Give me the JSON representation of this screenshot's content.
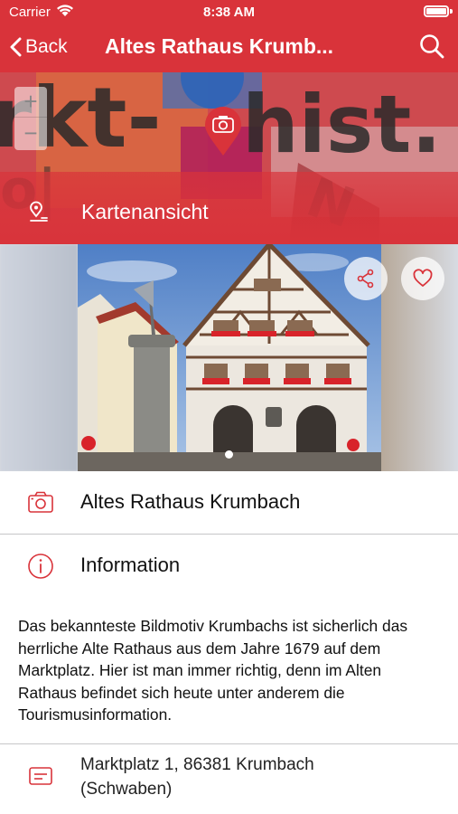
{
  "status_bar": {
    "carrier": "Carrier",
    "time": "8:38 AM"
  },
  "nav": {
    "back_label": "Back",
    "title": "Altes Rathaus Krumb...",
    "icons": [
      "back-chevron-icon",
      "search-icon"
    ]
  },
  "map": {
    "zoom_in": "+",
    "zoom_out": "−",
    "link_label": "Kartenansicht",
    "icons": [
      "map-pin-icon",
      "camera-pin-icon"
    ]
  },
  "carousel": {
    "image_count": 1,
    "active_index": 0,
    "icons": [
      "share-icon",
      "heart-icon"
    ]
  },
  "details": {
    "title_row": "Altes Rathaus Krumbach",
    "info_row": "Information",
    "description": "Das bekannteste Bildmotiv Krumbachs ist sicherlich das herrliche Alte Rathaus aus dem Jahre 1679 auf dem Marktplatz. Hier ist man immer richtig, denn im Alten Rathaus befindet sich heute unter anderem die Tourismusinformation.",
    "address_line1": "Marktplatz 1, 86381 Krumbach",
    "address_line2": "(Schwaben)"
  },
  "colors": {
    "accent": "#d9333a",
    "divider": "#c6c6c8",
    "text": "#111111"
  }
}
